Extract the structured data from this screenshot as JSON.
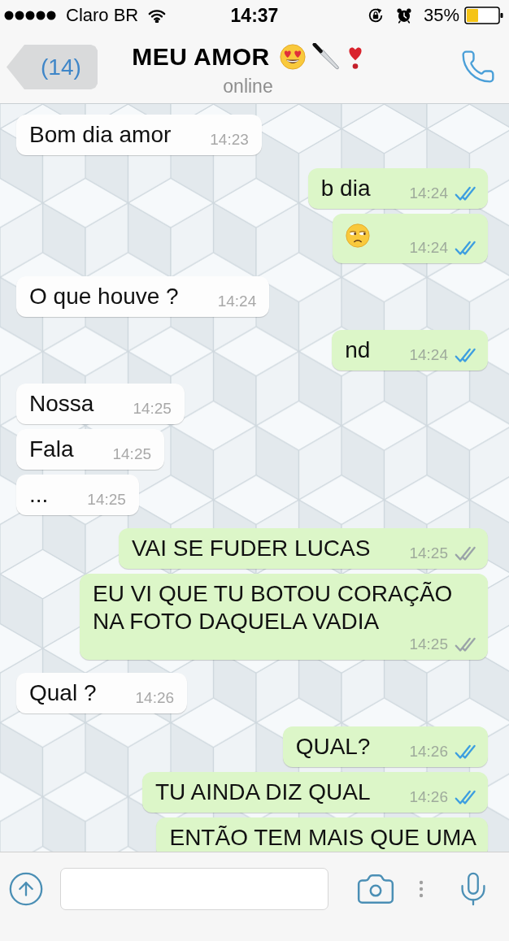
{
  "status_bar": {
    "carrier": "Claro BR",
    "time": "14:37",
    "battery": "35%"
  },
  "header": {
    "back_label": "(14)",
    "title": "MEU AMOR",
    "status": "online"
  },
  "messages": [
    {
      "outgoing": false,
      "kind": "text",
      "text": "Bom dia amor",
      "time": "14:23"
    },
    {
      "outgoing": true,
      "kind": "text",
      "text": "b dia",
      "time": "14:24",
      "read": true
    },
    {
      "outgoing": true,
      "kind": "emoji",
      "time": "14:24",
      "read": true
    },
    {
      "outgoing": false,
      "kind": "text",
      "text": "O que houve ?",
      "time": "14:24"
    },
    {
      "outgoing": true,
      "kind": "text",
      "text": "nd",
      "time": "14:24",
      "read": true
    },
    {
      "outgoing": false,
      "kind": "text",
      "text": "Nossa",
      "time": "14:25"
    },
    {
      "outgoing": false,
      "kind": "text",
      "text": "Fala",
      "time": "14:25"
    },
    {
      "outgoing": false,
      "kind": "text",
      "text": "...",
      "time": "14:25"
    },
    {
      "outgoing": true,
      "kind": "text",
      "text": "VAI SE FUDER LUCAS",
      "time": "14:25",
      "read": false
    },
    {
      "outgoing": true,
      "kind": "text",
      "text": "EU VI QUE TU BOTOU CORAÇÃO NA FOTO DAQUELA VADIA",
      "time": "14:25",
      "read": false
    },
    {
      "outgoing": false,
      "kind": "text",
      "text": "Qual ?",
      "time": "14:26"
    },
    {
      "outgoing": true,
      "kind": "text",
      "text": "QUAL?",
      "time": "14:26",
      "read": true
    },
    {
      "outgoing": true,
      "kind": "text",
      "text": "TU AINDA DIZ QUAL",
      "time": "14:26",
      "read": true
    },
    {
      "outgoing": true,
      "kind": "text",
      "text": "ENTÃO TEM MAIS QUE UMA"
    }
  ]
}
